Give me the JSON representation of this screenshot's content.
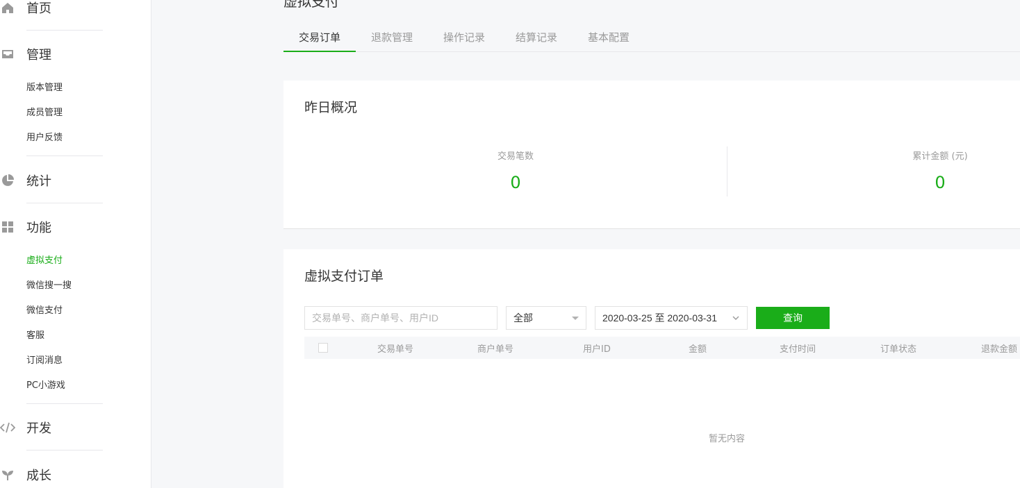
{
  "sidebar": {
    "groups": [
      {
        "label": "首页",
        "icon": "home-icon"
      },
      {
        "label": "管理",
        "icon": "inbox-icon",
        "items": [
          "版本管理",
          "成员管理",
          "用户反馈"
        ]
      },
      {
        "label": "统计",
        "icon": "pie-chart-icon"
      },
      {
        "label": "功能",
        "icon": "grid-icon",
        "items": [
          "虚拟支付",
          "微信搜一搜",
          "微信支付",
          "客服",
          "订阅消息",
          "PC小游戏"
        ]
      },
      {
        "label": "开发",
        "icon": "code-icon"
      },
      {
        "label": "成长",
        "icon": "sprout-icon"
      }
    ],
    "active_item": "虚拟支付",
    "accent_color": "#1aad19"
  },
  "page_title": "虚拟支付",
  "tabs": [
    "交易订单",
    "退款管理",
    "操作记录",
    "结算记录",
    "基本配置"
  ],
  "active_tab": "交易订单",
  "overview": {
    "title": "昨日概况",
    "stats": [
      {
        "label": "交易笔数",
        "value": "0"
      },
      {
        "label": "累计金额 (元)",
        "value": "0"
      }
    ]
  },
  "orders": {
    "title": "虚拟支付订单",
    "search_placeholder": "交易单号、商户单号、用户ID",
    "status_select": "全部",
    "date_range": "2020-03-25 至 2020-03-31",
    "query_label": "查询",
    "columns": [
      "交易单号",
      "商户单号",
      "用户ID",
      "金额",
      "支付时间",
      "订单状态",
      "退款金额"
    ],
    "empty_text": "暂无内容"
  }
}
